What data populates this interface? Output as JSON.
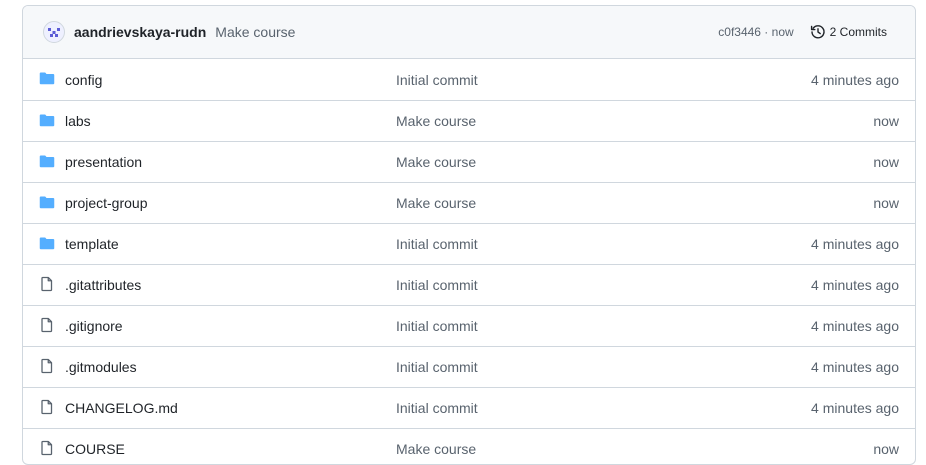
{
  "commit": {
    "author": "aandrievskaya-rudn",
    "message": "Make course",
    "sha": "c0f3446",
    "separator": " · ",
    "time": "now",
    "commits_label": "2 Commits"
  },
  "colors": {
    "folder": "#54aeff",
    "file": "#59636e",
    "border": "#d0d7de"
  },
  "files": [
    {
      "name": "config",
      "type": "folder",
      "message": "Initial commit",
      "age": "4 minutes ago"
    },
    {
      "name": "labs",
      "type": "folder",
      "message": "Make course",
      "age": "now"
    },
    {
      "name": "presentation",
      "type": "folder",
      "message": "Make course",
      "age": "now"
    },
    {
      "name": "project-group",
      "type": "folder",
      "message": "Make course",
      "age": "now"
    },
    {
      "name": "template",
      "type": "folder",
      "message": "Initial commit",
      "age": "4 minutes ago"
    },
    {
      "name": ".gitattributes",
      "type": "file",
      "message": "Initial commit",
      "age": "4 minutes ago"
    },
    {
      "name": ".gitignore",
      "type": "file",
      "message": "Initial commit",
      "age": "4 minutes ago"
    },
    {
      "name": ".gitmodules",
      "type": "file",
      "message": "Initial commit",
      "age": "4 minutes ago"
    },
    {
      "name": "CHANGELOG.md",
      "type": "file",
      "message": "Initial commit",
      "age": "4 minutes ago"
    },
    {
      "name": "COURSE",
      "type": "file",
      "message": "Make course",
      "age": "now"
    }
  ]
}
